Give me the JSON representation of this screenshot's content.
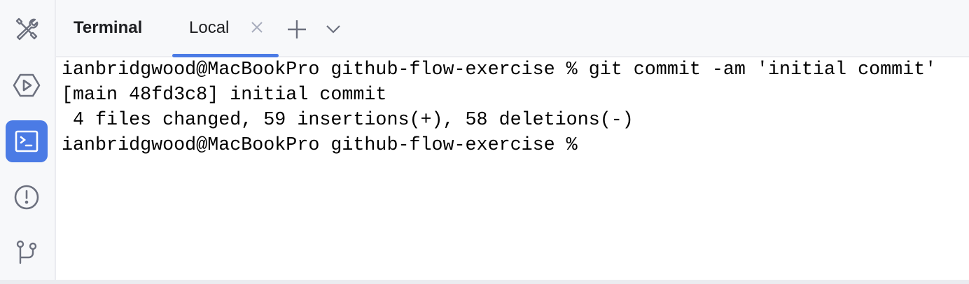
{
  "sidebar": {
    "items": [
      {
        "name": "build-tools",
        "icon": "wrench-screwdriver-icon"
      },
      {
        "name": "run",
        "icon": "run-hexagon-icon"
      },
      {
        "name": "terminal",
        "icon": "terminal-icon",
        "active": true
      },
      {
        "name": "problems",
        "icon": "exclamation-circle-icon"
      },
      {
        "name": "git",
        "icon": "git-branch-icon"
      }
    ]
  },
  "header": {
    "title": "Terminal",
    "tabs": [
      {
        "label": "Local",
        "active": true
      }
    ]
  },
  "colors": {
    "accent": "#4b7be5",
    "icon": "#6c707e"
  },
  "terminal": {
    "lines": [
      "ianbridgwood@MacBookPro github-flow-exercise % git commit -am 'initial commit'",
      "[main 48fd3c8] initial commit",
      " 4 files changed, 59 insertions(+), 58 deletions(-)",
      "ianbridgwood@MacBookPro github-flow-exercise % "
    ]
  }
}
